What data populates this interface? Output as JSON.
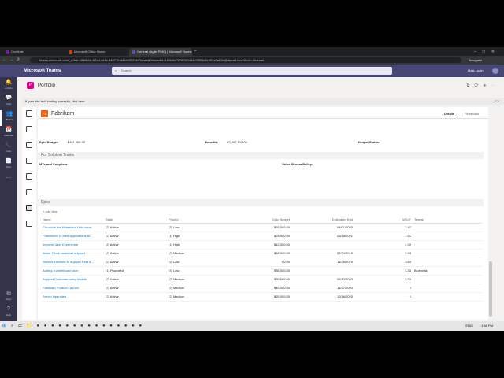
{
  "browser": {
    "tabs": [
      {
        "label": "OneNote",
        "color": "#7719aa"
      },
      {
        "label": "Microsoft Office Home",
        "color": "#d83b01"
      },
      {
        "label": "General (Agile PMO) | Microsoft Teams",
        "color": "#5558af"
      }
    ],
    "url": "teams.microsoft.com/_#/tab::d9b9c0e-67cd-4e5c-9407-2ddd9a43025b/General?threadId=19:9e8476061634d4c2f805d5c953a7e50b@thread.tacv2&ctx=channel",
    "profile": "Incognito"
  },
  "teams": {
    "app_name": "Microsoft Teams",
    "search_placeholder": "Search",
    "user": "Mats Login",
    "rail": [
      {
        "label": "Activity",
        "glyph": "🔔"
      },
      {
        "label": "Chat",
        "glyph": "💬"
      },
      {
        "label": "Teams",
        "glyph": "👥"
      },
      {
        "label": "Calendar",
        "glyph": "📅"
      },
      {
        "label": "Calls",
        "glyph": "📞"
      },
      {
        "label": "Files",
        "glyph": "📄"
      },
      {
        "label": "",
        "glyph": "…"
      },
      {
        "label": "Apps",
        "glyph": "⊞"
      },
      {
        "label": "Help",
        "glyph": "?"
      }
    ]
  },
  "app": {
    "title": "Portfolio",
    "icon_letter": "P",
    "warning": "If your site isn't loading correctly, click here"
  },
  "report": {
    "org_badge": "Fa",
    "org_name": "Fabrikam",
    "tabs": [
      "Details",
      "Financials"
    ],
    "fields": {
      "epic_budget_label": "Epic Budget:",
      "epic_budget_value": "$481,065.00",
      "benefits_label": "Benefits:",
      "benefits_value": "$2,402,915.00",
      "budget_status_label": "Budget Status:",
      "mts_label": "MTs and Suppliers:",
      "vsp_label": "Value Stream Policy:"
    },
    "section_solution": "For Solution Trains",
    "section_epics": "Epics",
    "add_item": "+ Add Item",
    "columns": [
      "Name",
      "State",
      "Priority",
      "Epic Budget",
      "Estimated End",
      "WSJF",
      "Teams"
    ],
    "rows": [
      [
        "Chronicle the Hinterland Hub occur...",
        "(2) Active",
        "(3) Low",
        "$76,000.00",
        "04/01/2020",
        "1.47",
        ""
      ],
      [
        "Framework to alert applications to...",
        "(2) Active",
        "(1) High",
        "$78,900.00",
        "03/15/2021",
        "1.52",
        ""
      ],
      [
        "Improve User Experience",
        "(2) Active",
        "(1) High",
        "$12,000.00",
        "",
        "4.39",
        ""
      ],
      [
        "World-Class customer support",
        "(2) Active",
        "(2) Medium",
        "$58,000.00",
        "07/24/2019",
        "2.93",
        ""
      ],
      [
        "Service interface to support Rest A...",
        "(2) Active",
        "(3) Low",
        "$0.00",
        "11/25/2019",
        "3.68",
        ""
      ],
      [
        "Adding a whiteboard user",
        "(1) Proposed",
        "(3) Low",
        "$35,000.00",
        "",
        "1.34",
        "Bluepeak"
      ],
      [
        "Support Customer using Mobile",
        "(2) Active",
        "(2) Medium",
        "$65,665.00",
        "06/12/2020",
        "2.29",
        ""
      ],
      [
        "Fabrikam Product Launch",
        "(2) Active",
        "(2) Medium",
        "$45,000.00",
        "11/27/2020",
        "0",
        ""
      ],
      [
        "Server Upgrades",
        "(2) Active",
        "(2) Medium",
        "$25,000.00",
        "12/16/2020",
        "0",
        ""
      ]
    ]
  },
  "taskbar": {
    "lang": "ENG",
    "time": "1:58 PM"
  }
}
